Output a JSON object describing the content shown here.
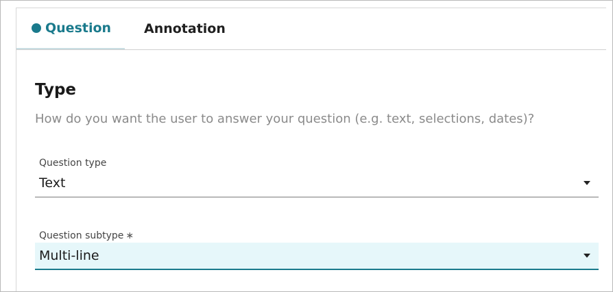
{
  "tabs": [
    {
      "label": "Question",
      "active": true
    },
    {
      "label": "Annotation",
      "active": false
    }
  ],
  "section": {
    "title": "Type",
    "description": "How do you want the user to answer your question (e.g. text, selections, dates)?"
  },
  "fields": {
    "question_type": {
      "label": "Question type",
      "value": "Text"
    },
    "question_subtype": {
      "label": "Question subtype",
      "required_marker": "∗",
      "value": "Multi-line"
    }
  },
  "colors": {
    "accent": "#1a7a8c",
    "focus_bg": "#e6f7fa",
    "muted_text": "#8a8a8a"
  }
}
